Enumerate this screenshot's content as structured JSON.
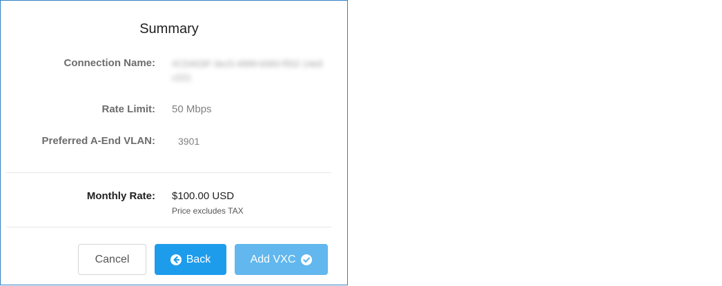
{
  "summary": {
    "title": "Summary",
    "fields": {
      "connection_name": {
        "label": "Connection Name:",
        "value": "#CDA03F-3ec5-4999-b583-f552 14e9c221"
      },
      "rate_limit": {
        "label": "Rate Limit:",
        "value": "50 Mbps"
      },
      "preferred_vlan": {
        "label": "Preferred A-End VLAN:",
        "value": "3901"
      }
    },
    "monthly_rate": {
      "label": "Monthly Rate:",
      "value": "$100.00 USD",
      "note": "Price excludes TAX"
    }
  },
  "actions": {
    "cancel_label": "Cancel",
    "back_label": "Back",
    "add_label": "Add VXC",
    "back_icon": "arrow-left-circle-icon",
    "add_icon": "check-circle-icon"
  },
  "colors": {
    "primary": "#1e9cec",
    "primary_disabled": "#61b7ee",
    "panel_border": "#2f7fc1"
  }
}
